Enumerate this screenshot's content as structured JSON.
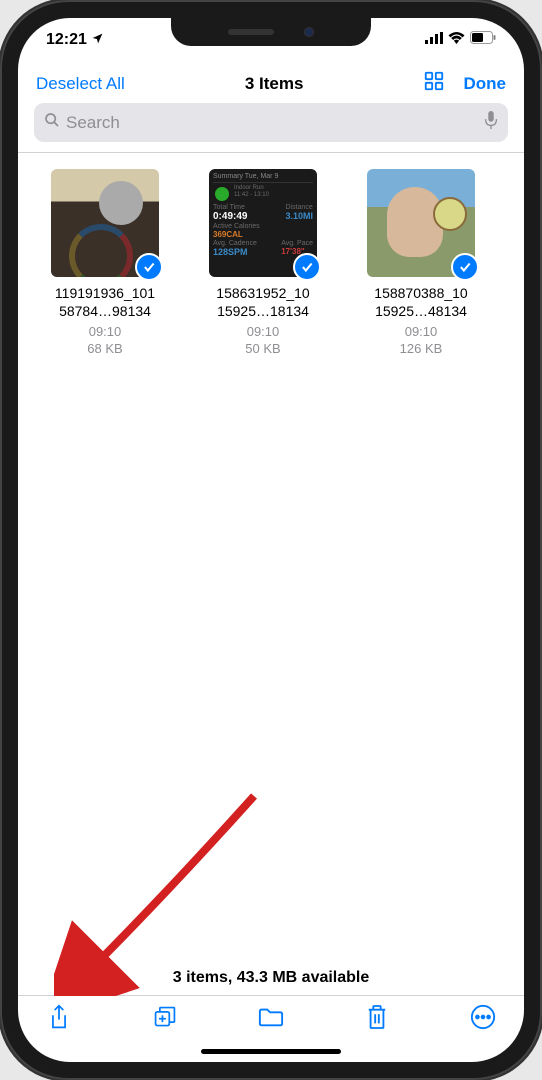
{
  "status": {
    "time": "12:21",
    "location_icon": "location-arrow"
  },
  "nav": {
    "deselect": "Deselect All",
    "title": "3 Items",
    "done": "Done"
  },
  "search": {
    "placeholder": "Search"
  },
  "files": [
    {
      "name_line1": "119191936_101",
      "name_line2": "58784…98134",
      "time": "09:10",
      "size": "68 KB",
      "selected": true
    },
    {
      "name_line1": "158631952_10",
      "name_line2": "15925…18134",
      "time": "09:10",
      "size": "50 KB",
      "selected": true
    },
    {
      "name_line1": "158870388_10",
      "name_line2": "15925…48134",
      "time": "09:10",
      "size": "126 KB",
      "selected": true
    }
  ],
  "summary": "3 items, 43.3 MB available",
  "workout_thumb": {
    "header": "Summary    Tue, Mar 9",
    "type": "Indoor Run",
    "time_range": "11:42 - 13:10",
    "total_label": "Total Time",
    "total": "0:49:49",
    "dist_label": "Distance",
    "dist": "3.10MI",
    "cal_label": "Active Calories",
    "cal": "369CAL",
    "cad_label": "Avg. Cadence",
    "cad": "128SPM",
    "pace_label": "Avg. Pace",
    "pace": "17'38\""
  }
}
